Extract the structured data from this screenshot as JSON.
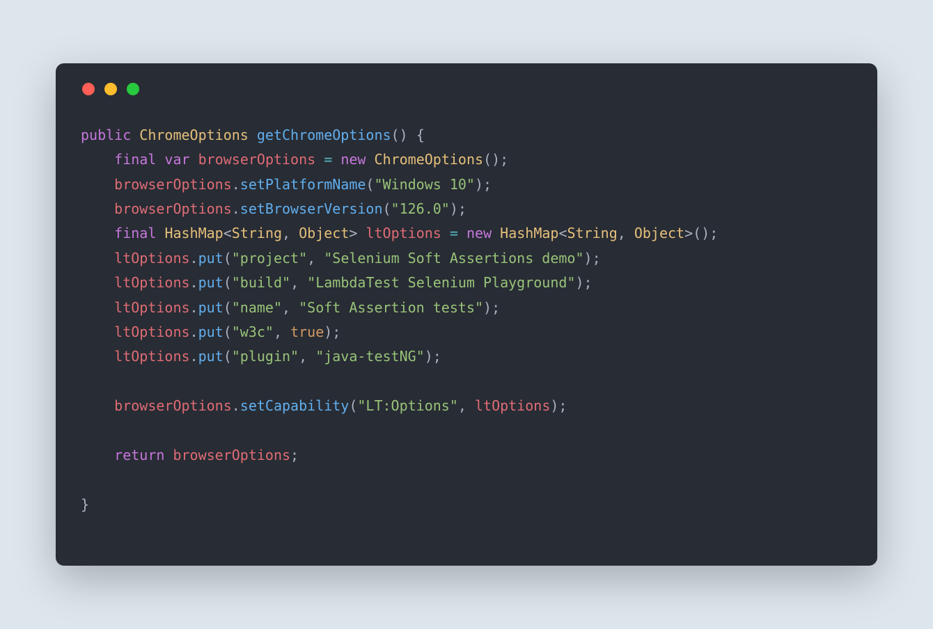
{
  "colors": {
    "bg_page": "#dde6ed",
    "bg_window": "#282c34",
    "dot_red": "#ff5f56",
    "dot_yellow": "#ffbd2e",
    "dot_green": "#27c93f",
    "keyword": "#c678dd",
    "type": "#e5c07b",
    "function": "#61afef",
    "identifier": "#e06c75",
    "string": "#98c379",
    "literal": "#d19a66",
    "operator": "#56b6c2",
    "default": "#abb2bf"
  },
  "code": {
    "kw_public": "public",
    "type_ChromeOptions": "ChromeOptions",
    "fn_getChromeOptions": "getChromeOptions",
    "pn_open_paren": "(",
    "pn_close_paren": ")",
    "pn_open_brace": "{",
    "pn_close_brace": "}",
    "pn_semi": ";",
    "pn_comma": ",",
    "pn_dot": ".",
    "kw_final": "final",
    "kw_var": "var",
    "id_browserOptions": "browserOptions",
    "op_eq": "=",
    "kw_new": "new",
    "fn_setPlatformName": "setPlatformName",
    "str_windows10": "\"Windows 10\"",
    "fn_setBrowserVersion": "setBrowserVersion",
    "str_126": "\"126.0\"",
    "type_HashMap": "HashMap",
    "type_String": "String",
    "type_Object": "Object",
    "pn_lt": "<",
    "pn_gt": ">",
    "id_ltOptions": "ltOptions",
    "fn_put": "put",
    "str_project": "\"project\"",
    "str_project_val": "\"Selenium Soft Assertions demo\"",
    "str_build": "\"build\"",
    "str_build_val": "\"LambdaTest Selenium Playground\"",
    "str_name": "\"name\"",
    "str_name_val": "\"Soft Assertion tests\"",
    "str_w3c": "\"w3c\"",
    "lit_true": "true",
    "str_plugin": "\"plugin\"",
    "str_plugin_val": "\"java-testNG\"",
    "fn_setCapability": "setCapability",
    "str_ltoptions": "\"LT:Options\"",
    "kw_return": "return"
  }
}
